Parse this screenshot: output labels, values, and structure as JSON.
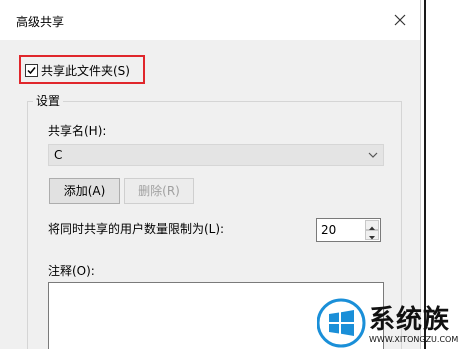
{
  "dialog": {
    "title": "高级共享"
  },
  "share_checkbox": {
    "label": "共享此文件夹(S)",
    "checked": true
  },
  "settings": {
    "group_title": "设置",
    "share_name_label": "共享名(H):",
    "share_name_value": "C",
    "add_button": "添加(A)",
    "remove_button": "删除(R)",
    "limit_label": "将同时共享的用户数量限制为(L):",
    "limit_value": "20",
    "comment_label": "注释(O):",
    "comment_value": ""
  },
  "watermark": {
    "brand": "系统族",
    "url": "WWW.XITONGZU.COM"
  },
  "colors": {
    "highlight": "#e0262b",
    "logo_blue": "#1a8fd8"
  },
  "icons": [
    "close-icon",
    "checkmark-icon",
    "chevron-down-icon",
    "spin-up-icon",
    "spin-down-icon",
    "windows-logo-icon"
  ]
}
